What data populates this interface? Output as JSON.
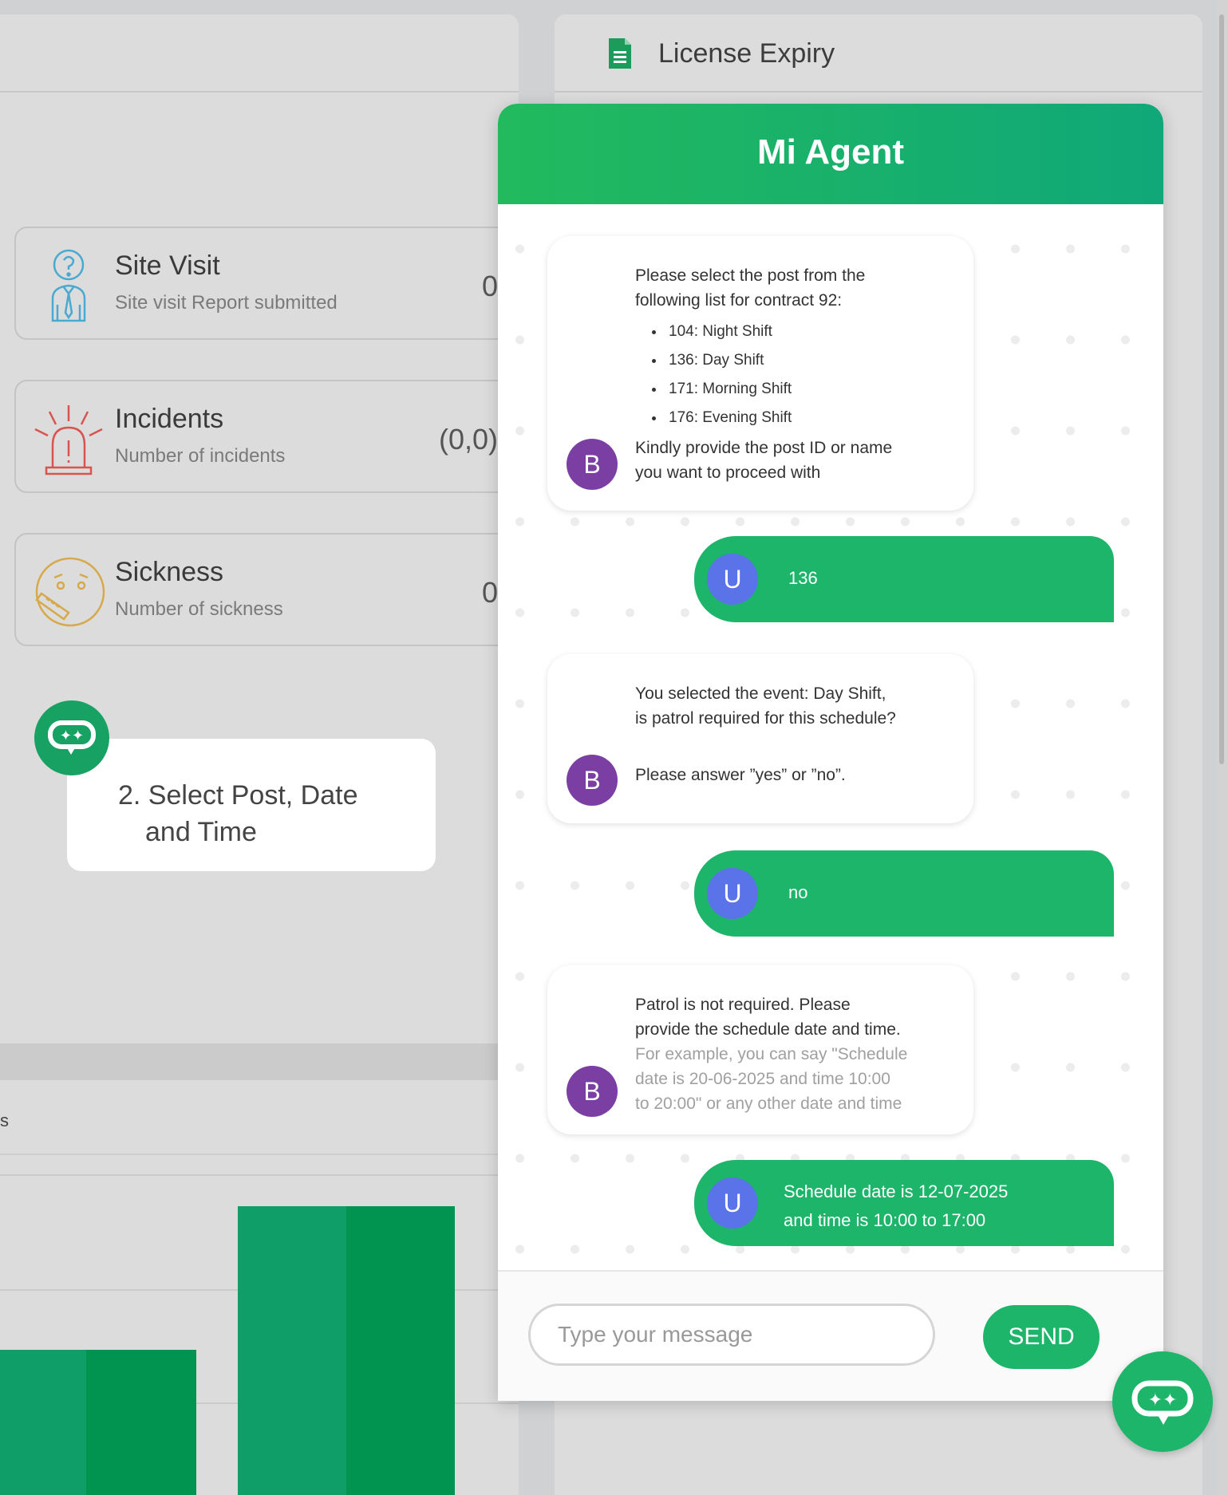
{
  "license": {
    "title": "License Expiry"
  },
  "stats": [
    {
      "title": "Site Visit",
      "subtitle": "Site visit Report submitted",
      "value": "0"
    },
    {
      "title": "Incidents",
      "subtitle": "Number of incidents",
      "value": "(0,0)"
    },
    {
      "title": "Sickness",
      "subtitle": "Number of sickness",
      "value": "0"
    }
  ],
  "tip": {
    "line1": "2. Select Post, Date",
    "line2": "and Time"
  },
  "lower": {
    "edge_char": "s"
  },
  "chat": {
    "title": "Mi Agent",
    "bot_initial": "B",
    "user_initial": "U",
    "messages": {
      "m1": {
        "intro_1": "Please select the post from the",
        "intro_2": "following list for contract 92:",
        "items": [
          "104:  Night Shift",
          "136:  Day Shift",
          "171:   Morning Shift",
          "176:  Evening Shift"
        ],
        "outro_1": "Kindly provide the post ID or name",
        "outro_2": "you want to proceed with"
      },
      "u1": "136",
      "m2": {
        "line_1": "You selected the event: Day Shift,",
        "line_2": "is patrol required for this schedule?",
        "line_3": "Please answer ”yes” or ”no”."
      },
      "u2": "no",
      "m3": {
        "line_1": "Patrol is not required. Please",
        "line_2": "provide the schedule date and time.",
        "hint_1": "For example, you can say \"Schedule",
        "hint_2": "date is 20-06-2025 and time 10:00",
        "hint_3": "to 20:00\" or any other date and time"
      },
      "u3": {
        "line_1": "Schedule date is 12-07-2025",
        "line_2": "and time is 10:00 to 17:00"
      }
    },
    "input_placeholder": "Type your message",
    "send_label": "SEND"
  },
  "colors": {
    "brand_green": "#1db56a",
    "bot_avatar": "#7b3fa4",
    "user_avatar": "#5b73e8",
    "bar_green": "#0f9e68"
  },
  "icons": [
    "document-icon",
    "site-visit-icon",
    "incident-alarm-icon",
    "sickness-icon",
    "chatbot-icon"
  ]
}
